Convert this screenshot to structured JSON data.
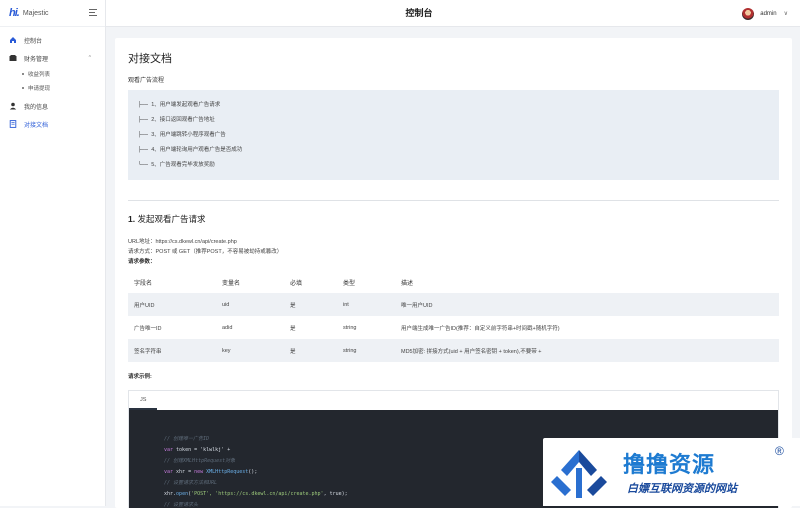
{
  "brand": {
    "logo": "hi.",
    "name": "Majestic"
  },
  "sidebar": {
    "items": [
      {
        "label": "控制台"
      },
      {
        "label": "财务管理",
        "sub": [
          "收益列表",
          "申请提现"
        ]
      },
      {
        "label": "我的信息"
      },
      {
        "label": "对接文档"
      }
    ]
  },
  "header": {
    "title": "控制台",
    "user": "admin"
  },
  "doc": {
    "title": "对接文档",
    "flow_label": "观看广告流程",
    "flow": [
      "1、用户端发起观看广告请求",
      "2、接口返回观看广告地址",
      "3、用户端跳转小程序观看广告",
      "4、用户端轮询用户观看广告是否成功",
      "5、广告观看完毕发放奖励"
    ],
    "section_num": "1.",
    "section_title": "发起观看广告请求",
    "url_line": "URL地址：https://cs.dkewl.cn/api/create.php",
    "method_line": "请求方式：POST 或 GET（推荐POST，不容易被劫持或篡改）",
    "params_label": "请求参数：",
    "table": {
      "headers": [
        "字段名",
        "变量名",
        "必填",
        "类型",
        "描述"
      ],
      "rows": [
        [
          "用户UID",
          "uid",
          "是",
          "int",
          "唯一用户UID"
        ],
        [
          "广告唯一ID",
          "adid",
          "是",
          "string",
          "用户端生成唯一广告ID(推荐：自定义前字符串+时间戳+随机字符)"
        ],
        [
          "签名字符串",
          "key",
          "是",
          "string",
          "MD5加密: 拼接方式(uid + 用户签名密钥 + token),不要带 +"
        ]
      ]
    },
    "example_label": "请求示例:",
    "code_tab": "JS",
    "code": {
      "c1": "// 创建唯一广告ID",
      "l2_kw": "var",
      "l2_rest": " token = 'klwlkj' +",
      "c3": "// 创建XMLHttpRequest对象",
      "l4_kw": "var",
      "l4_mid": " xhr = ",
      "l4_kw2": "new",
      "l4_fn": " XMLHttpRequest",
      "l4_end": "();",
      "c5": "// 设置请求方法和URL",
      "l6_a": "xhr.",
      "l6_fn": "open",
      "l6_b": "(",
      "l6_str": "'POST', 'https://cs.dkewl.cn/api/create.php'",
      "l6_c": ", true);",
      "c7": "// 设置请求头"
    }
  },
  "watermark": {
    "title": "撸撸资源",
    "reg": "®",
    "subtitle": "白嫖互联网资源的网站"
  }
}
